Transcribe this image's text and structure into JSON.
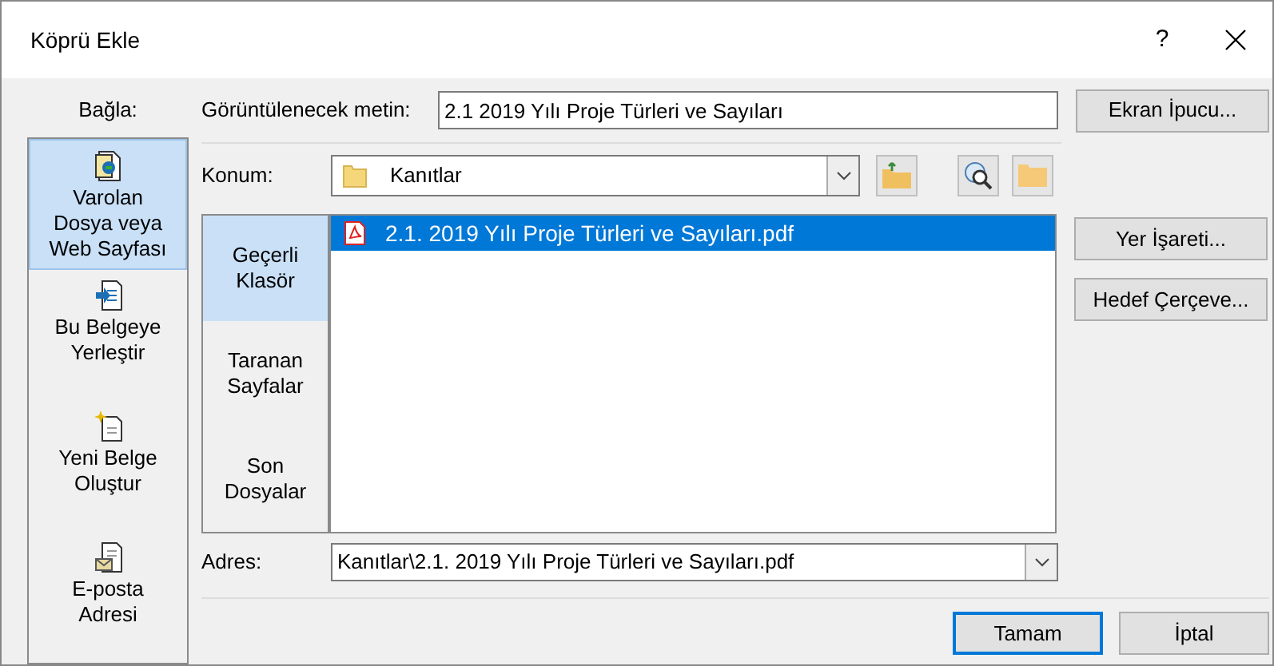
{
  "window": {
    "title": "Köprü Ekle",
    "help": "?"
  },
  "link_to": {
    "label": "Bağla:",
    "items": [
      {
        "kind": "file",
        "label": "Varolan Dosya veya Web Sayfası",
        "selected": true
      },
      {
        "kind": "place",
        "label": "Bu Belgeye Yerleştir",
        "selected": false
      },
      {
        "kind": "new",
        "label": "Yeni Belge Oluştur",
        "selected": false
      },
      {
        "kind": "email",
        "label": "E-posta Adresi",
        "selected": false
      }
    ]
  },
  "display_text": {
    "label": "Görüntülenecek metin:",
    "value": "2.1 2019 Yılı Proje Türleri ve Sayıları"
  },
  "screen_tip_button": "Ekran İpucu...",
  "location": {
    "label": "Konum:",
    "value": "Kanıtlar"
  },
  "look_in": [
    {
      "label": "Geçerli Klasör",
      "selected": true
    },
    {
      "label": "Taranan Sayfalar",
      "selected": false
    },
    {
      "label": "Son Dosyalar",
      "selected": false
    }
  ],
  "files": [
    {
      "name": "2.1. 2019 Yılı Proje Türleri ve Sayıları.pdf",
      "selected": true
    }
  ],
  "side_buttons": [
    "Yer İşareti...",
    "Hedef Çerçeve..."
  ],
  "address": {
    "label": "Adres:",
    "value": "Kanıtlar\\2.1. 2019 Yılı Proje Türleri ve Sayıları.pdf"
  },
  "buttons": [
    {
      "label": "Tamam",
      "default": true
    },
    {
      "label": "İptal",
      "default": false
    }
  ]
}
